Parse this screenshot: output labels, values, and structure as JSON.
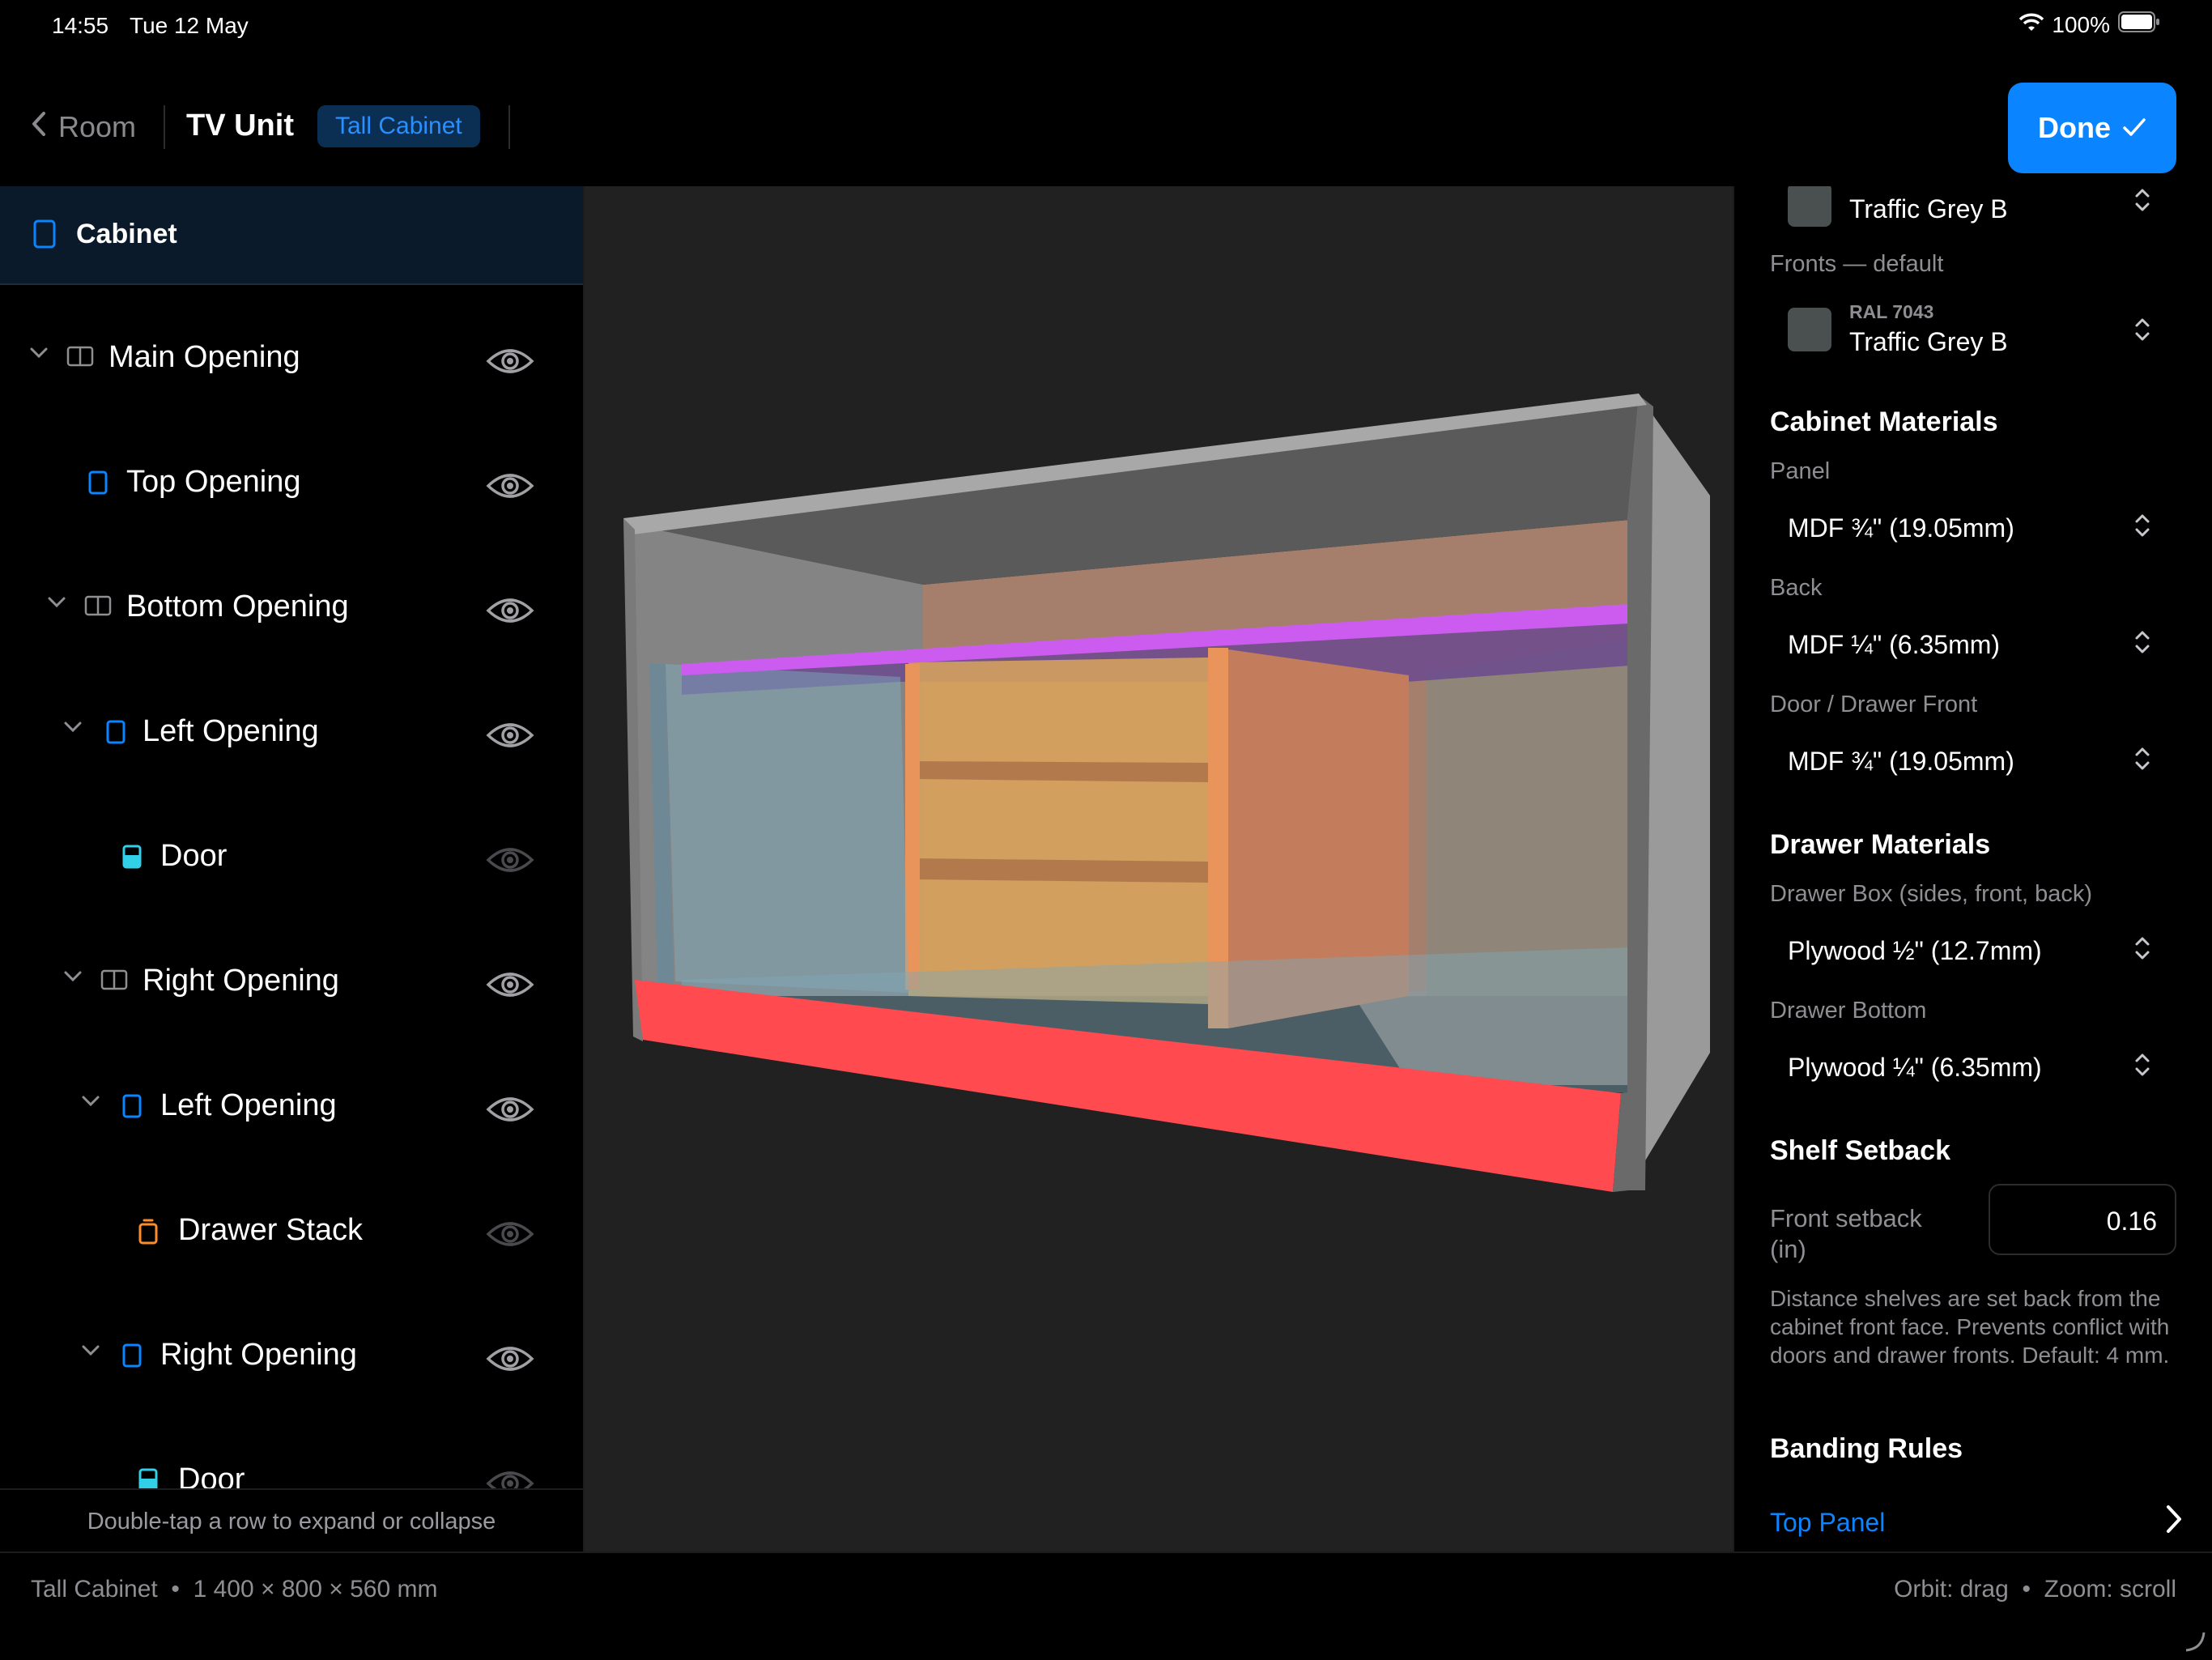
{
  "status_bar": {
    "time": "14:55",
    "date": "Tue 12 May",
    "battery": "100%"
  },
  "nav": {
    "back_label": "Room",
    "title": "TV Unit",
    "badge": "Tall Cabinet",
    "done_label": "Done"
  },
  "tree": {
    "root_label": "Cabinet",
    "rows": [
      {
        "label": "Main Opening",
        "icon": "split-icon"
      },
      {
        "label": "Top Opening",
        "icon": "opening-icon"
      },
      {
        "label": "Bottom Opening",
        "icon": "split-icon"
      },
      {
        "label": "Left Opening",
        "icon": "opening-icon"
      },
      {
        "label": "Door",
        "icon": "door-icon"
      },
      {
        "label": "Right Opening",
        "icon": "split-icon"
      },
      {
        "label": "Left Opening",
        "icon": "opening-icon"
      },
      {
        "label": "Drawer Stack",
        "icon": "drawer-icon"
      },
      {
        "label": "Right Opening",
        "icon": "opening-icon"
      },
      {
        "label": "Door",
        "icon": "door-icon"
      }
    ],
    "hint": "Double-tap a row to expand or collapse"
  },
  "properties": {
    "carcass_color_name": "Traffic Grey B",
    "fronts_label": "Fronts — default",
    "fronts_ral": "RAL 7043",
    "fronts_color_name": "Traffic Grey B",
    "cabinet_materials": {
      "title": "Cabinet Materials",
      "panel_label": "Panel",
      "panel_value": "MDF ¾\" (19.05mm)",
      "back_label": "Back",
      "back_value": "MDF ¼\" (6.35mm)",
      "door_label": "Door / Drawer Front",
      "door_value": "MDF ¾\" (19.05mm)"
    },
    "drawer_materials": {
      "title": "Drawer Materials",
      "box_label": "Drawer Box (sides, front, back)",
      "box_value": "Plywood ½\" (12.7mm)",
      "bottom_label": "Drawer Bottom",
      "bottom_value": "Plywood ¼\" (6.35mm)"
    },
    "shelf_setback": {
      "title": "Shelf Setback",
      "field_label": "Front setback (in)",
      "value": "0.16",
      "description": "Distance shelves are set back from the cabinet front face. Prevents conflict with doors and drawer fronts. Default: 4 mm."
    },
    "banding": {
      "title": "Banding Rules",
      "link": "Top Panel"
    }
  },
  "footer": {
    "summary": "Tall Cabinet  •  1 400 × 800 × 560 mm",
    "hint": "Orbit: drag  •  Zoom: scroll"
  },
  "colors": {
    "accent": "#0a84ff",
    "swatch": "#4a4f4f",
    "plinth": "#ff4a4f",
    "shelf": "#cc5cf0"
  }
}
